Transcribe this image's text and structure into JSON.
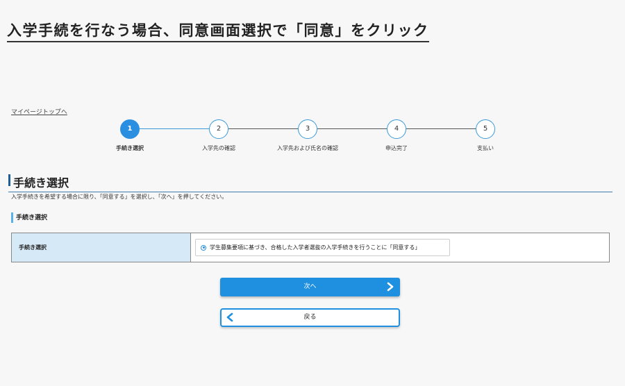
{
  "page_heading": "入学手続を行なう場合、同意画面選択で「同意」をクリック",
  "mypage_link": "マイページトップへ",
  "steps": [
    {
      "number": "1",
      "label": "手続き選択"
    },
    {
      "number": "2",
      "label": "入学先の確認"
    },
    {
      "number": "3",
      "label": "入学先および氏名の確認"
    },
    {
      "number": "4",
      "label": "申込完了"
    },
    {
      "number": "5",
      "label": "支払い"
    }
  ],
  "current_step": 1,
  "section_title": "手続き選択",
  "instruction": "入学手続きを希望する場合に限り、「同意する」を選択し、「次へ」を押してください。",
  "sub_title": "手続き選択",
  "form": {
    "label": "手続き選択",
    "option_text": "学生募集要項に基づき、合格した入学者選抜の入学手続きを行うことに「同意する」",
    "option_selected": true
  },
  "buttons": {
    "next_label": "次へ",
    "back_label": "戻る"
  },
  "colors": {
    "accent": "#1f8fe0",
    "label_cell_bg": "#d6e9f7",
    "section_bar": "#1f5e99"
  }
}
